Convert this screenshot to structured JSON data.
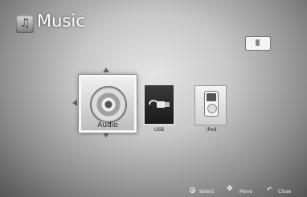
{
  "header": {
    "title": "Music",
    "icon": "music-note-icon"
  },
  "top_right": {
    "icon": "device-icon"
  },
  "navigation": {
    "arrows": [
      "arrow-up-icon",
      "arrow-down-icon",
      "arrow-left-icon",
      "arrow-right-icon"
    ]
  },
  "items": [
    {
      "label": "Audio",
      "icon": "disc-icon",
      "selected": true
    },
    {
      "label": "USB",
      "icon": "usb-icon",
      "selected": false
    },
    {
      "label": "iPod",
      "icon": "ipod-icon",
      "selected": false
    }
  ],
  "footer": {
    "select": "Select",
    "move": "Move",
    "close": "Close"
  }
}
